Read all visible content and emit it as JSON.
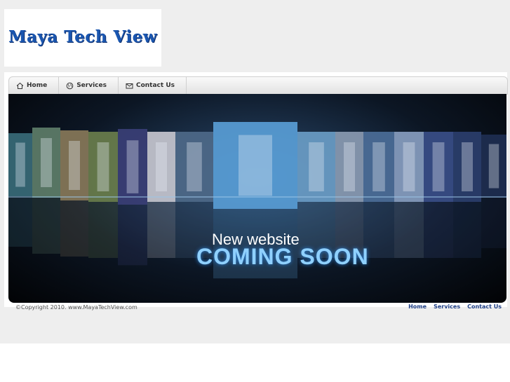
{
  "logo": {
    "text": "Maya Tech View"
  },
  "nav": {
    "items": [
      {
        "label": "Home",
        "icon": "home-icon"
      },
      {
        "label": "Services",
        "icon": "globe-icon"
      },
      {
        "label": "Contact Us",
        "icon": "mail-icon"
      }
    ]
  },
  "banner": {
    "line1": "New website",
    "line2": "COMING SOON"
  },
  "footer": {
    "copyright": "©Copyright 2010. www.MayaTechView.com",
    "links": [
      "Home",
      "Services",
      "Contact Us"
    ]
  },
  "colors": {
    "logo": "#1a56b0",
    "coming_soon": "#8fd0ff",
    "footer_link": "#1f3f86"
  }
}
